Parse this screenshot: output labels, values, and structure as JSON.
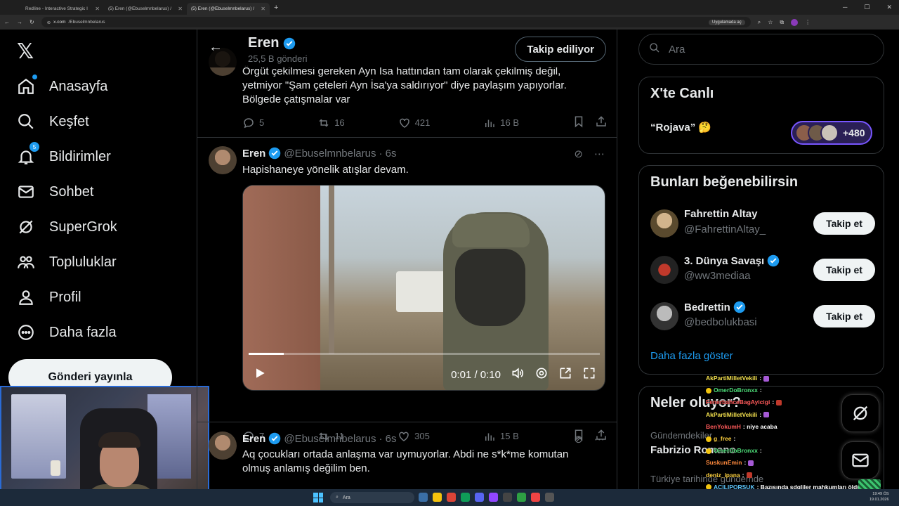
{
  "browser": {
    "tabs": [
      {
        "title": "Redline - Interactive Strategic I",
        "active": false
      },
      {
        "title": "(5) Eren (@Ebuselmnbelarus) /",
        "active": false
      },
      {
        "title": "(5) Eren (@Ebuselmnbelarus) /",
        "active": true
      }
    ],
    "url_domain": "x.com",
    "url_path": "/Ebuselmnbelarus",
    "app_pill": "Uygulamada aç"
  },
  "nav": {
    "items": [
      {
        "label": "Anasayfa",
        "icon": "home-icon"
      },
      {
        "label": "Keşfet",
        "icon": "search-icon"
      },
      {
        "label": "Bildirimler",
        "icon": "bell-icon",
        "badge": "5"
      },
      {
        "label": "Sohbet",
        "icon": "mail-icon"
      },
      {
        "label": "SuperGrok",
        "icon": "grok-icon"
      },
      {
        "label": "Topluluklar",
        "icon": "communities-icon"
      },
      {
        "label": "Profil",
        "icon": "profile-icon"
      },
      {
        "label": "Daha fazla",
        "icon": "more-icon"
      }
    ],
    "post_button": "Gönderi yayınla"
  },
  "header": {
    "name": "Eren",
    "count": "25,5 B gönderi",
    "follow_label": "Takip ediliyor"
  },
  "tweets": [
    {
      "text": "Örgüt çekilmesi gereken Ayn Isa hattından tam olarak çekilmiş değil, yetmiyor \"Şam çeteleri Ayn İsa'ya saldırıyor\" diye paylaşım yapıyorlar. Bölgede çatışmalar var",
      "replies": "5",
      "reposts": "16",
      "likes": "421",
      "views": "16 B"
    },
    {
      "name": "Eren",
      "handle": "@Ebuselmnbelarus",
      "time": "· 6s",
      "text": "Hapishaneye yönelik atışlar devam.",
      "video": {
        "time": "0:01 / 0:10",
        "progress": 0.1
      },
      "replies": "7",
      "reposts": "11",
      "likes": "305",
      "views": "15 B"
    },
    {
      "name": "Eren",
      "handle": "@Ebuselmnbelarus",
      "time": "· 6s",
      "text": "Aq çocukları ortada anlaşma var uymuyorlar. Abdi ne s*k*me komutan olmuş anlamış değilim ben."
    }
  ],
  "right": {
    "search_placeholder": "Ara",
    "live": {
      "title": "X'te Canlı",
      "topic": "“Rojava” 🤔",
      "count": "+480"
    },
    "suggest": {
      "title": "Bunları beğenebilirsin",
      "users": [
        {
          "name": "Fahrettin Altay",
          "handle": "@FahrettinAltay_",
          "verified": false,
          "button": "Takip et"
        },
        {
          "name": "3. Dünya Savaşı",
          "handle": "@ww3mediaa",
          "verified": true,
          "button": "Takip et"
        },
        {
          "name": "Bedrettin",
          "handle": "@bedbolukbasi",
          "verified": true,
          "button": "Takip et"
        }
      ],
      "show_more": "Daha fazla göster"
    },
    "trends": {
      "title": "Neler oluyor?",
      "items": [
        {
          "sub": "Gündemdekiler",
          "name": "Fabrizio Romano"
        },
        {
          "sub": "Türkiye tarihinde gündemde",
          "name": ""
        }
      ]
    }
  },
  "chat": [
    {
      "user": "AkPartiMilletVekili",
      "msg": ":",
      "color": "u1"
    },
    {
      "user": "OmerDoBronxx",
      "msg": ":",
      "color": "u3"
    },
    {
      "user": "FenerbahceBagAyicigi",
      "msg": ":",
      "color": "u2"
    },
    {
      "user": "AkPartiMilletVekili",
      "msg": ":",
      "color": "u1"
    },
    {
      "user": "BenYokumH",
      "msg": ": niye acaba",
      "color": "u2"
    },
    {
      "user": "g_free",
      "msg": ":",
      "color": "u4"
    },
    {
      "user": "OmerDoBronxx",
      "msg": ":",
      "color": "u3"
    },
    {
      "user": "SuskunEmin",
      "msg": ":",
      "color": "u6"
    },
    {
      "user": "deniz_ipana",
      "msg": ":",
      "color": "u4"
    },
    {
      "user": "ACILIPORSUK",
      "msg": ": Bazısında sdgliler mahkumları öldürdü",
      "color": "u5"
    }
  ],
  "taskbar": {
    "search": "Ara",
    "time": "19:49 ÖS",
    "date": "19.01.2026"
  }
}
